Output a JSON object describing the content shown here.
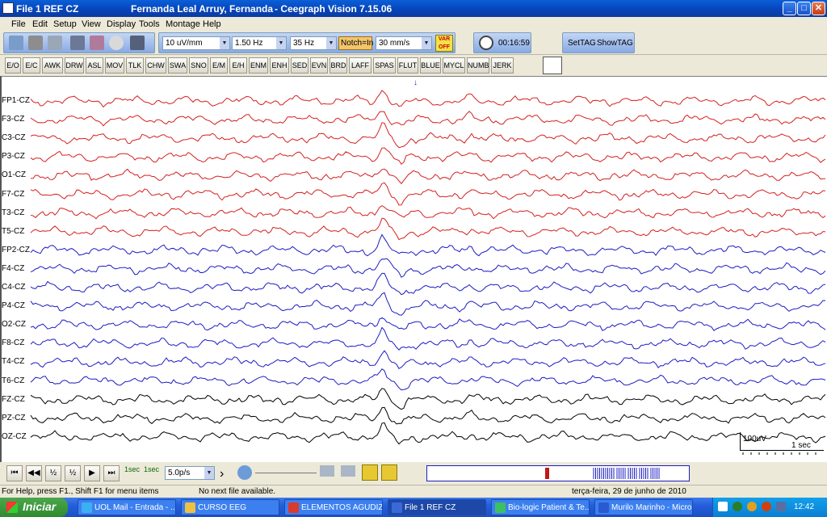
{
  "window": {
    "file_label": "File 1   REF CZ",
    "patient": "Fernanda Leal Arruy, Fernanda",
    "app": "- Ceegraph Vision  7.15.06",
    "min_icon": "minimize-icon",
    "max_icon": "maximize-icon",
    "close_icon": "close-icon"
  },
  "menu": [
    "File",
    "Edit",
    "Setup",
    "View",
    "Display",
    "Tools",
    "Montage",
    "Help"
  ],
  "toolbar": {
    "sensitivity": "10 uV/mm",
    "low_filter": "1.50 Hz",
    "high_filter": "35 Hz",
    "notch": "Notch=In",
    "speed": "30 mm/s",
    "var": "VAR OFF",
    "timer": "00:16:59",
    "settag": "SetTAG",
    "showtag": "ShowTAG"
  },
  "events": [
    "E/O",
    "E/C",
    "AWK",
    "DRW",
    "ASL",
    "MOV",
    "TLK",
    "CHW",
    "SWA",
    "SNO",
    "E/M",
    "E/H",
    "ENM",
    "ENH",
    "SED",
    "EVN",
    "BRD",
    "LAFF",
    "SPAS",
    "FLUT",
    "BLUE",
    "MYCL",
    "NUMB",
    "JERK"
  ],
  "channels": [
    {
      "label": "FP1-CZ",
      "color": "#d42020"
    },
    {
      "label": "F3-CZ",
      "color": "#d42020"
    },
    {
      "label": "C3-CZ",
      "color": "#d42020"
    },
    {
      "label": "P3-CZ",
      "color": "#d42020"
    },
    {
      "label": "O1-CZ",
      "color": "#d42020"
    },
    {
      "label": "F7-CZ",
      "color": "#d42020"
    },
    {
      "label": "T3-CZ",
      "color": "#d42020"
    },
    {
      "label": "T5-CZ",
      "color": "#d42020"
    },
    {
      "label": "FP2-CZ",
      "color": "#1c1cc4"
    },
    {
      "label": "F4-CZ",
      "color": "#1c1cc4"
    },
    {
      "label": "C4-CZ",
      "color": "#1c1cc4"
    },
    {
      "label": "P4-CZ",
      "color": "#1c1cc4"
    },
    {
      "label": "O2-CZ",
      "color": "#1c1cc4"
    },
    {
      "label": "F8-CZ",
      "color": "#1c1cc4"
    },
    {
      "label": "T4-CZ",
      "color": "#1c1cc4"
    },
    {
      "label": "T6-CZ",
      "color": "#1c1cc4"
    },
    {
      "label": "FZ-CZ",
      "color": "#000000"
    },
    {
      "label": "PZ-CZ",
      "color": "#000000"
    },
    {
      "label": "OZ-CZ",
      "color": "#000000"
    }
  ],
  "scale": {
    "amplitude": "100uV",
    "time": "1 sec"
  },
  "bottom": {
    "playback_speed": "5.0p/s",
    "sec_label": "1sec"
  },
  "status": {
    "help": "For Help, press F1., Shift F1 for menu items",
    "next_file": "No next file available.",
    "date": "terça-feira, 29 de junho de 2010"
  },
  "taskbar": {
    "start": "Iniciar",
    "tasks": [
      {
        "label": "UOL Mail - Entrada - ...",
        "active": false
      },
      {
        "label": "CURSO EEG",
        "active": false
      },
      {
        "label": "ELEMENTOS AGUDIZ...",
        "active": false
      },
      {
        "label": "File 1   REF CZ",
        "active": true
      },
      {
        "label": "Bio-logic Patient & Te...",
        "active": false
      },
      {
        "label": "Murilo Marinho - Micro...",
        "active": false
      }
    ],
    "clock": "12:42"
  }
}
